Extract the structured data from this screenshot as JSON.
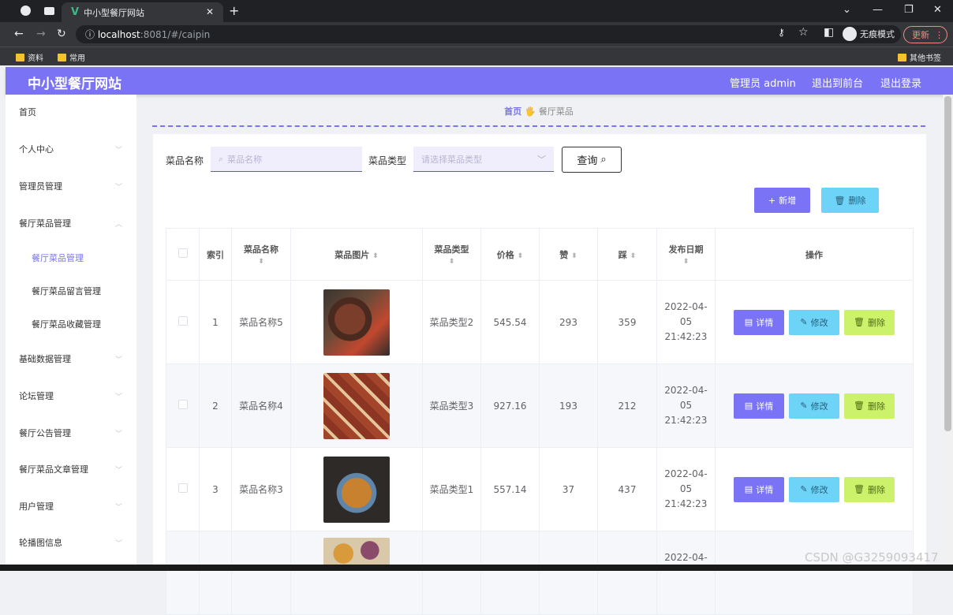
{
  "browser": {
    "tab_title": "中小型餐厅网站",
    "url_host": "localhost",
    "url_rest": ":8081/#/caipin",
    "incognito_label": "无痕模式",
    "update_label": "更新",
    "bookmarks": [
      "资料",
      "常用"
    ],
    "other_bookmarks": "其他书签"
  },
  "header": {
    "brand": "中小型餐厅网站",
    "admin": "管理员 admin",
    "to_front": "退出到前台",
    "logout": "退出登录"
  },
  "sidebar": {
    "items": [
      {
        "label": "首页"
      },
      {
        "label": "个人中心"
      },
      {
        "label": "管理员管理"
      },
      {
        "label": "餐厅菜品管理"
      },
      {
        "label": "餐厅菜品管理"
      },
      {
        "label": "餐厅菜品留言管理"
      },
      {
        "label": "餐厅菜品收藏管理"
      },
      {
        "label": "基础数据管理"
      },
      {
        "label": "论坛管理"
      },
      {
        "label": "餐厅公告管理"
      },
      {
        "label": "餐厅菜品文章管理"
      },
      {
        "label": "用户管理"
      },
      {
        "label": "轮播图信息"
      }
    ]
  },
  "breadcrumb": {
    "home": "首页",
    "current": "餐厅菜品"
  },
  "search": {
    "name_label": "菜品名称",
    "name_placeholder": "菜品名称",
    "type_label": "菜品类型",
    "type_placeholder": "请选择菜品类型",
    "query_button": "查询"
  },
  "actions": {
    "add": "新增",
    "delete": "删除"
  },
  "table": {
    "headers": [
      "索引",
      "菜品名称",
      "菜品图片",
      "菜品类型",
      "价格",
      "赞",
      "踩",
      "发布日期",
      "操作"
    ],
    "rows": [
      {
        "index": "1",
        "name": "菜品名称5",
        "type": "菜品类型2",
        "price": "545.54",
        "like": "293",
        "dislike": "359",
        "date": "2022-04-05 21:42:23"
      },
      {
        "index": "2",
        "name": "菜品名称4",
        "type": "菜品类型3",
        "price": "927.16",
        "like": "193",
        "dislike": "212",
        "date": "2022-04-05 21:42:23"
      },
      {
        "index": "3",
        "name": "菜品名称3",
        "type": "菜品类型1",
        "price": "557.14",
        "like": "37",
        "dislike": "437",
        "date": "2022-04-05 21:42:23"
      },
      {
        "index": "",
        "name": "",
        "type": "",
        "price": "",
        "like": "",
        "dislike": "",
        "date": "2022-04-"
      }
    ],
    "row_buttons": {
      "detail": "详情",
      "edit": "修改",
      "delete": "删除"
    }
  },
  "watermark": "CSDN @G3259093417",
  "colors": {
    "accent": "#7a73f6",
    "cyan": "#6dd4f7",
    "lime": "#ccf26b"
  }
}
